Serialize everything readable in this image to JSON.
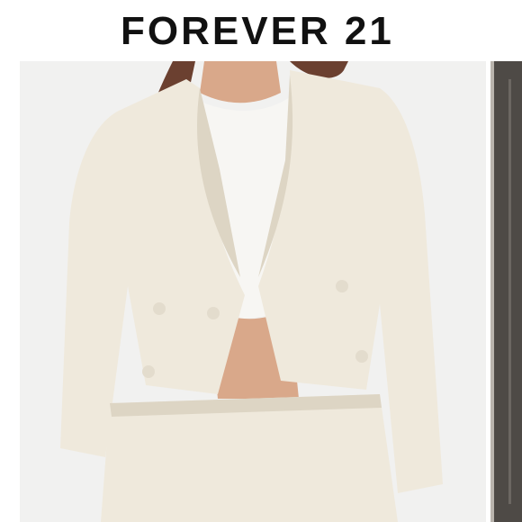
{
  "brand": {
    "logo_text": "FOREVER 21"
  },
  "photo": {
    "subject": "model-wearing-cream-boucle-cropped-jacket",
    "palette": {
      "background": "#f1f1f0",
      "jacket": "#efe9dc",
      "jacket_shadow": "#ddd5c4",
      "top": "#f7f6f3",
      "skin": "#d9a88a",
      "hair": "#6b4030"
    }
  },
  "side_photo": {
    "subject": "partial-next-image-dark-panel",
    "palette": {
      "panel": "#4e4a46",
      "edge": "#b9b4ad"
    }
  }
}
